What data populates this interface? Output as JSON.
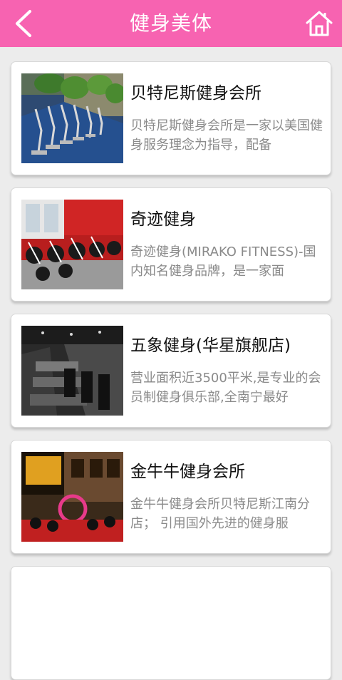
{
  "header": {
    "title": "健身美体",
    "back_icon": "chevron-left-icon",
    "home_icon": "home-icon",
    "color": "#f763b1"
  },
  "items": [
    {
      "title": "贝特尼斯健身会所",
      "desc": "贝特尼斯健身会所是一家以美国健身服务理念为指导，配备"
    },
    {
      "title": "奇迹健身",
      "desc": "奇迹健身(MIRAKO FITNESS)-国内知名健身品牌，是一家面"
    },
    {
      "title": "五象健身(华星旗舰店)",
      "desc": "营业面积近3500平米,是专业的会员制健身俱乐部,全南宁最好"
    },
    {
      "title": "金牛牛健身会所",
      "desc": "金牛牛健身会所贝特尼斯江南分店； 引用国外先进的健身服"
    }
  ]
}
